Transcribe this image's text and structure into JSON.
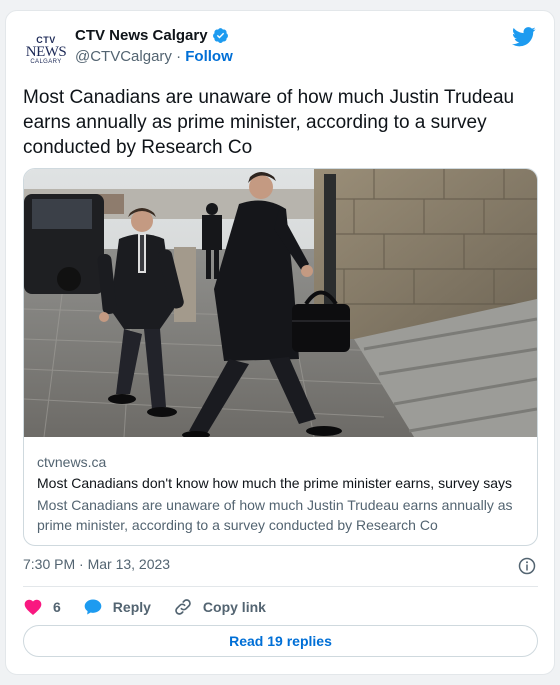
{
  "author": {
    "display_name": "CTV News Calgary",
    "handle": "@CTVCalgary",
    "follow_label": "Follow",
    "separator": " · ",
    "avatar_text": {
      "ctv": "CTV",
      "news": "NEWS",
      "city": "CALGARY"
    },
    "verified_icon": "verified-badge-icon"
  },
  "platform_icon": "twitter-bird-icon",
  "tweet": {
    "text": "Most Canadians are unaware of how much Justin Trudeau earns annually as prime minister, according to a survey conducted by Research Co"
  },
  "link_card": {
    "image_alt": "photo",
    "domain": "ctvnews.ca",
    "title": "Most Canadians don't know how much the prime minister earns, survey says",
    "description": "Most Canadians are unaware of how much Justin Trudeau earns annually as prime minister, according to a survey conducted by Research Co"
  },
  "timestamp": "7:30 PM · Mar 13, 2023",
  "actions": {
    "like_count": "6",
    "reply_label": "Reply",
    "copy_link_label": "Copy link"
  },
  "read_replies_label": "Read 19 replies",
  "colors": {
    "accent": "#006fd6",
    "heart": "#f91880",
    "twitter_blue": "#1d9bf0",
    "muted": "#536471"
  }
}
